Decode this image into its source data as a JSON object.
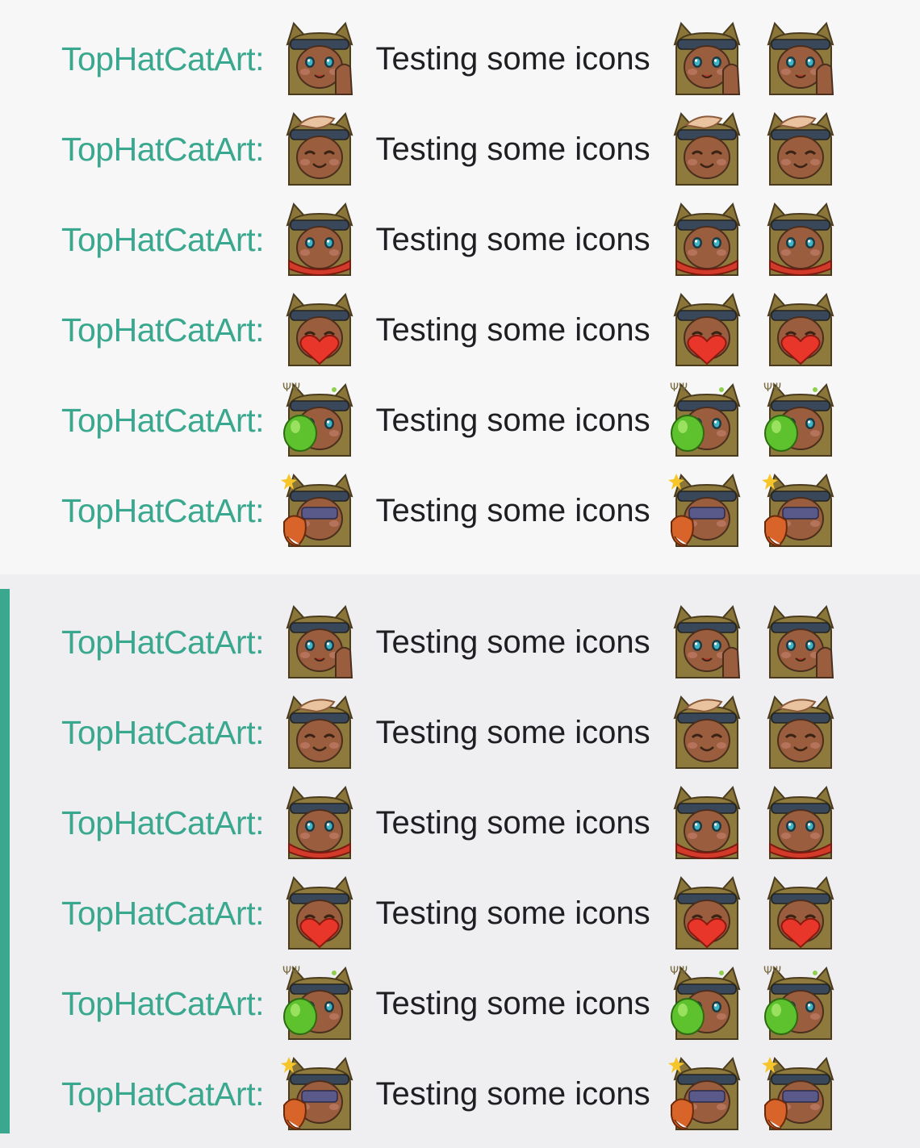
{
  "colors": {
    "username": "#3aa88e",
    "message": "#1f1f23",
    "background": "#f7f7f8",
    "highlight_background": "#efeff2",
    "highlight_accent": "#3aa88e"
  },
  "sections": [
    {
      "type": "normal",
      "messages": [
        {
          "username": "TopHatCatArt",
          "colon": ":",
          "text": "Testing some icons",
          "emote": "cat-wave-emote"
        },
        {
          "username": "TopHatCatArt",
          "colon": ":",
          "text": "Testing some icons",
          "emote": "cat-pat-emote"
        },
        {
          "username": "TopHatCatArt",
          "colon": ":",
          "text": "Testing some icons",
          "emote": "cat-scarf-emote"
        },
        {
          "username": "TopHatCatArt",
          "colon": ":",
          "text": "Testing some icons",
          "emote": "cat-heart-emote"
        },
        {
          "username": "TopHatCatArt",
          "colon": ":",
          "text": "Testing some icons",
          "emote": "cat-potion-emote"
        },
        {
          "username": "TopHatCatArt",
          "colon": ":",
          "text": "Testing some icons",
          "emote": "cat-fox-emote"
        }
      ]
    },
    {
      "type": "highlighted",
      "messages": [
        {
          "username": "TopHatCatArt",
          "colon": ":",
          "text": "Testing some icons",
          "emote": "cat-wave-emote"
        },
        {
          "username": "TopHatCatArt",
          "colon": ":",
          "text": "Testing some icons",
          "emote": "cat-pat-emote"
        },
        {
          "username": "TopHatCatArt",
          "colon": ":",
          "text": "Testing some icons",
          "emote": "cat-scarf-emote"
        },
        {
          "username": "TopHatCatArt",
          "colon": ":",
          "text": "Testing some icons",
          "emote": "cat-heart-emote"
        },
        {
          "username": "TopHatCatArt",
          "colon": ":",
          "text": "Testing some icons",
          "emote": "cat-potion-emote"
        },
        {
          "username": "TopHatCatArt",
          "colon": ":",
          "text": "Testing some icons",
          "emote": "cat-fox-emote"
        }
      ]
    }
  ]
}
